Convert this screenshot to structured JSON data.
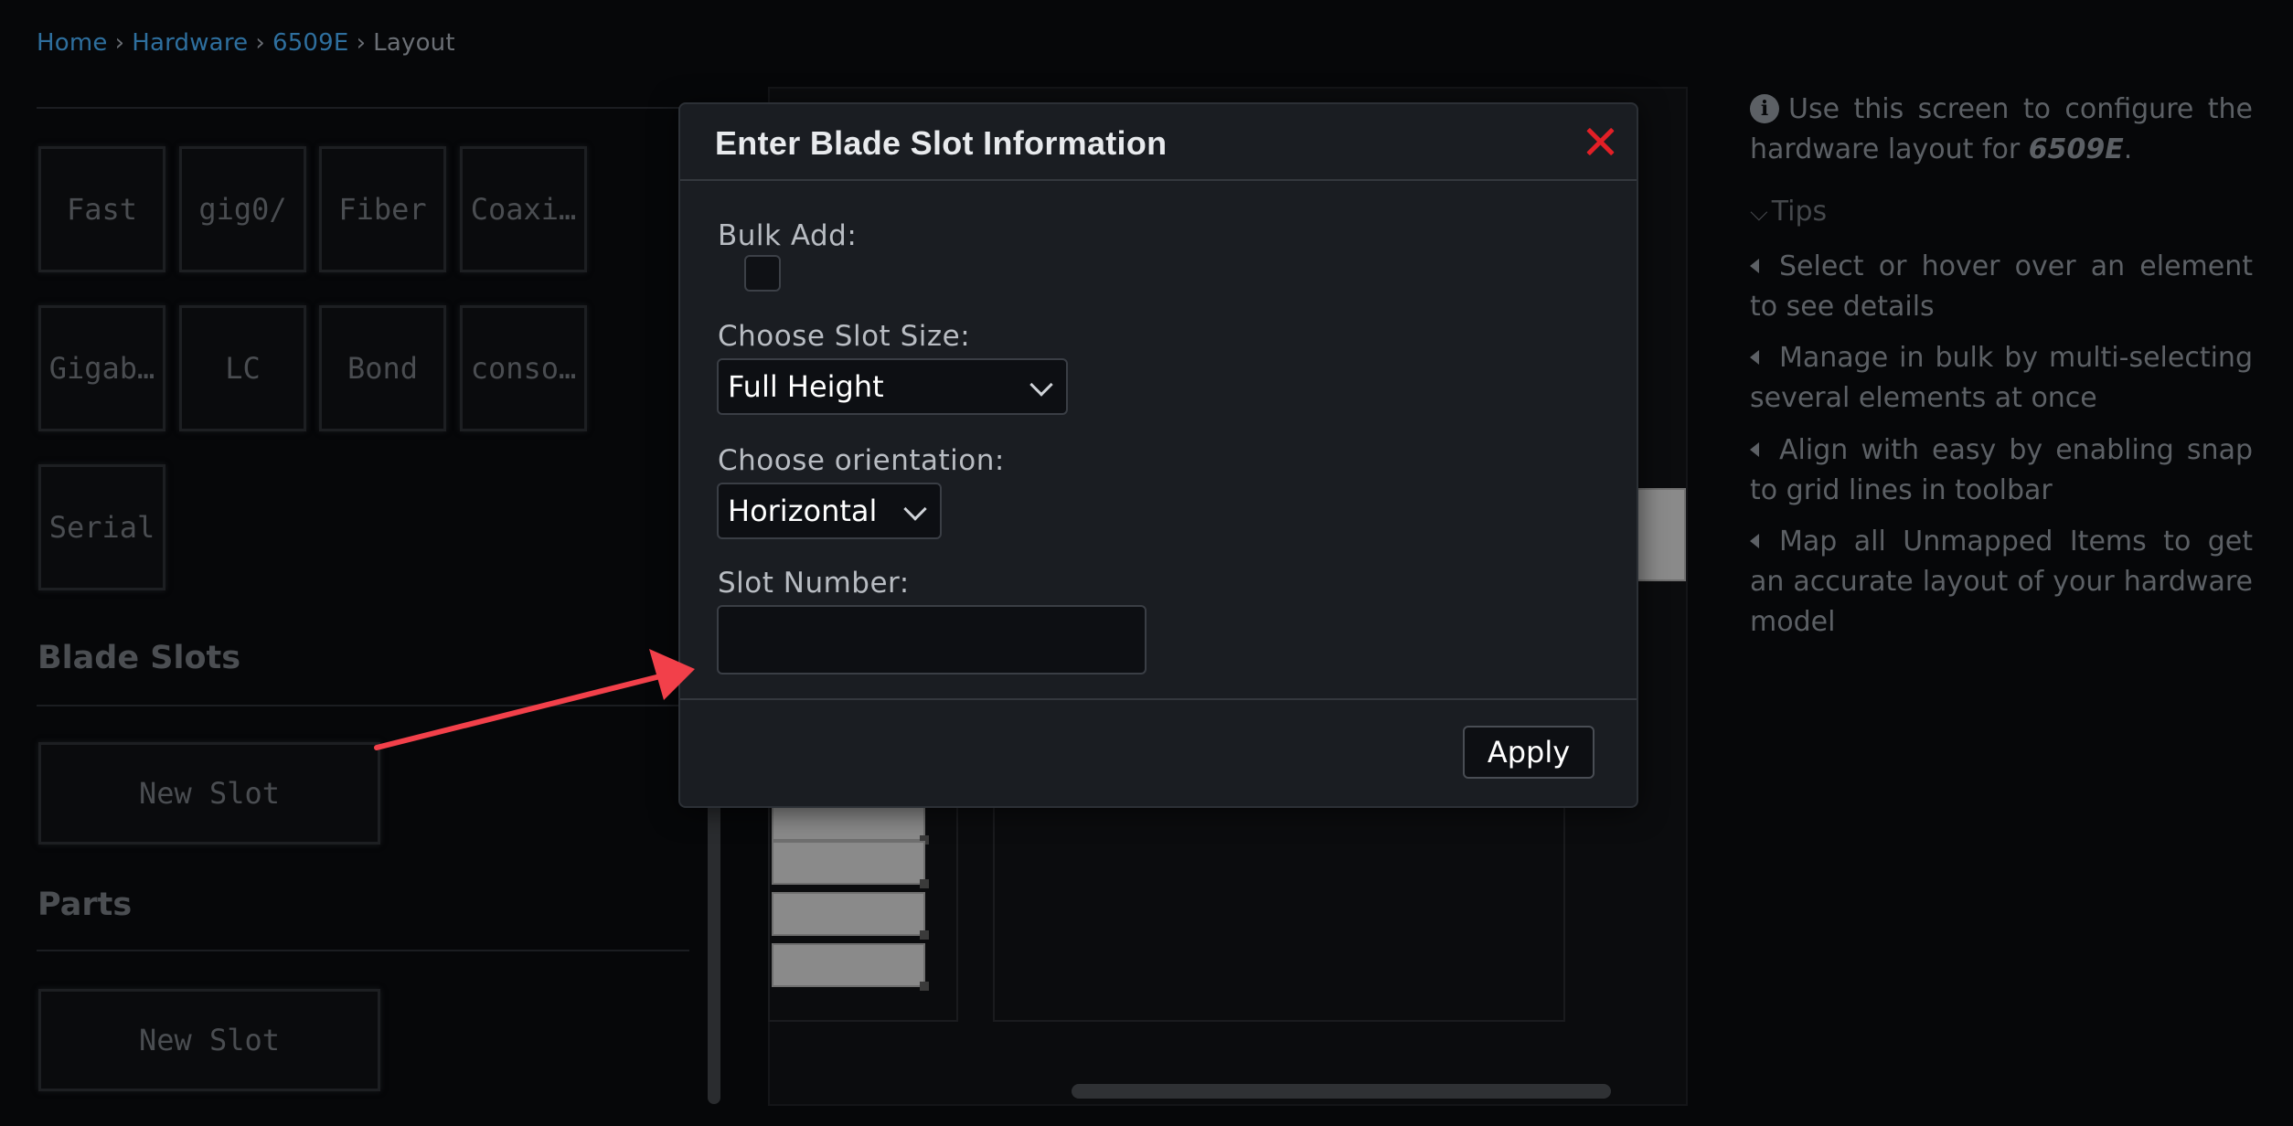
{
  "breadcrumb": {
    "items": [
      "Home",
      "Hardware",
      "6509E"
    ],
    "current": "Layout",
    "separator": "›"
  },
  "palette": {
    "tiles": [
      "Fast",
      "gig0/",
      "Fiber",
      "Coaxi…",
      "Gigab…",
      "LC",
      "Bond",
      "conso…",
      "Serial"
    ]
  },
  "sections": {
    "blade_slots": {
      "title": "Blade Slots",
      "item": "New Slot"
    },
    "parts": {
      "title": "Parts",
      "item": "New Slot"
    }
  },
  "info": {
    "text_before": "Use this screen to configure the hardware layout for ",
    "model": "6509E",
    "text_after": ".",
    "tips_label": "Tips",
    "tips": [
      "Select or hover over an element to see details",
      "Manage in bulk by multi-selecting several elements at once",
      "Align with easy by enabling snap to grid lines in toolbar",
      "Map all Unmapped Items to get an accurate layout of your hardware model"
    ]
  },
  "modal": {
    "title": "Enter Blade Slot Information",
    "bulk_add_label": "Bulk Add:",
    "slot_size_label": "Choose Slot Size:",
    "slot_size_value": "Full Height",
    "orientation_label": "Choose orientation:",
    "orientation_value": "Horizontal",
    "slot_number_label": "Slot Number:",
    "slot_number_value": "",
    "apply_label": "Apply"
  },
  "colors": {
    "accent_link": "#2e6f9e",
    "close_red": "#e21f26",
    "arrow_red": "#f2404a"
  }
}
